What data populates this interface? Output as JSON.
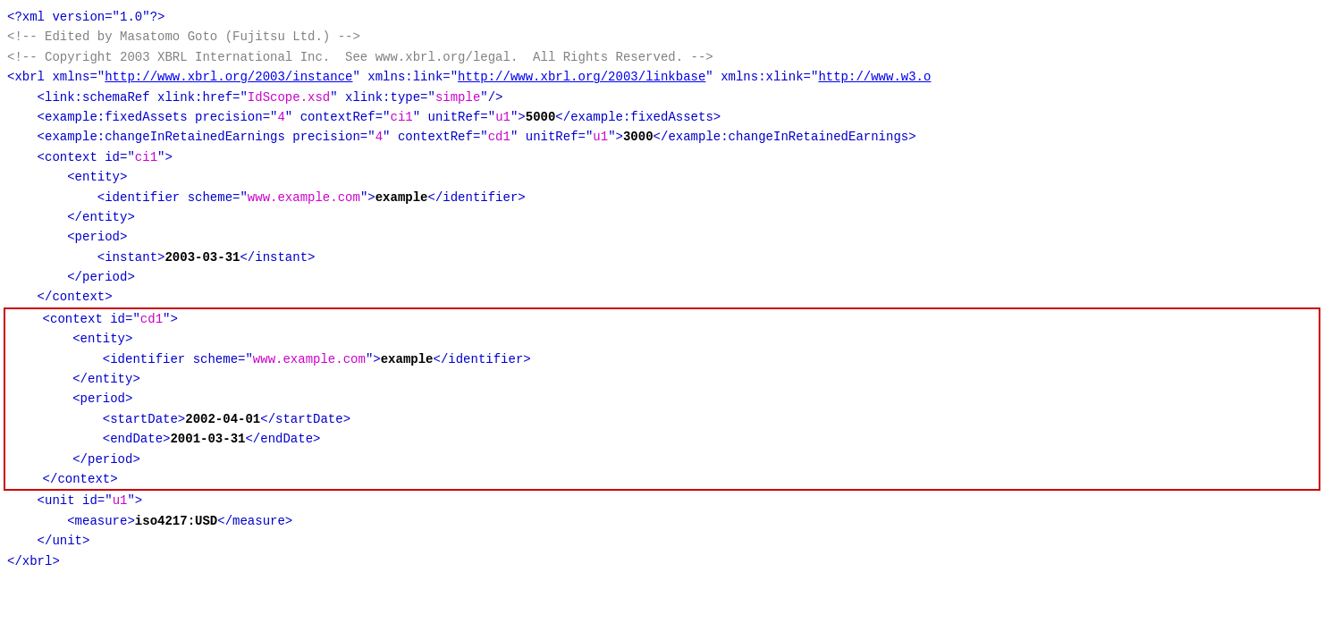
{
  "document": {
    "lines": [
      {
        "id": "line1",
        "type": "normal",
        "parts": [
          {
            "text": "<?xml version=\"1.0\"?>",
            "class": "color-blue"
          }
        ]
      },
      {
        "id": "line2",
        "type": "normal",
        "parts": [
          {
            "text": "<!-- Edited by Masatomo Goto (Fujitsu Ltd.) -->",
            "class": "color-comment"
          }
        ]
      },
      {
        "id": "line3",
        "type": "normal",
        "parts": [
          {
            "text": "<!-- Copyright 2003 XBRL International Inc.  See www.xbrl.org/legal.  All Rights Reserved. -->",
            "class": "color-comment"
          }
        ]
      },
      {
        "id": "line4",
        "type": "normal",
        "parts": [
          {
            "text": "<xbrl xmlns=\"",
            "class": "color-blue"
          },
          {
            "text": "http://www.xbrl.org/2003/instance",
            "class": "link"
          },
          {
            "text": "\" xmlns:link=\"",
            "class": "color-blue"
          },
          {
            "text": "http://www.xbrl.org/2003/linkbase",
            "class": "link"
          },
          {
            "text": "\" xmlns:xlink=\"",
            "class": "color-blue"
          },
          {
            "text": "http://www.w3.o",
            "class": "link"
          }
        ]
      },
      {
        "id": "line5",
        "type": "normal",
        "parts": [
          {
            "text": "    <link:schemaRef xlink:href=\"",
            "class": "color-blue"
          },
          {
            "text": "IdScope.xsd",
            "class": "color-magenta"
          },
          {
            "text": "\" xlink:type=\"",
            "class": "color-blue"
          },
          {
            "text": "simple",
            "class": "color-magenta"
          },
          {
            "text": "\"/>",
            "class": "color-blue"
          }
        ]
      },
      {
        "id": "line6",
        "type": "normal",
        "parts": [
          {
            "text": "    <example:fixedAssets precision=\"",
            "class": "color-blue"
          },
          {
            "text": "4",
            "class": "color-magenta"
          },
          {
            "text": "\" contextRef=\"",
            "class": "color-blue"
          },
          {
            "text": "ci1",
            "class": "color-magenta"
          },
          {
            "text": "\" unitRef=\"",
            "class": "color-blue"
          },
          {
            "text": "u1",
            "class": "color-magenta"
          },
          {
            "text": "\">",
            "class": "color-blue"
          },
          {
            "text": "5000",
            "class": "color-black bold"
          },
          {
            "text": "</example:fixedAssets>",
            "class": "color-blue"
          }
        ]
      },
      {
        "id": "line7",
        "type": "normal",
        "parts": [
          {
            "text": "    <example:changeInRetainedEarnings precision=\"",
            "class": "color-blue"
          },
          {
            "text": "4",
            "class": "color-magenta"
          },
          {
            "text": "\" contextRef=\"",
            "class": "color-blue"
          },
          {
            "text": "cd1",
            "class": "color-magenta"
          },
          {
            "text": "\" unitRef=\"",
            "class": "color-blue"
          },
          {
            "text": "u1",
            "class": "color-magenta"
          },
          {
            "text": "\">",
            "class": "color-blue"
          },
          {
            "text": "3000",
            "class": "color-black bold"
          },
          {
            "text": "</example:changeInRetainedEarnings>",
            "class": "color-blue"
          }
        ]
      },
      {
        "id": "line8",
        "type": "normal",
        "parts": [
          {
            "text": "    <context id=\"",
            "class": "color-blue"
          },
          {
            "text": "ci1",
            "class": "color-magenta"
          },
          {
            "text": "\">",
            "class": "color-blue"
          }
        ]
      },
      {
        "id": "line9",
        "type": "normal",
        "parts": [
          {
            "text": "        <entity>",
            "class": "color-blue"
          }
        ]
      },
      {
        "id": "line10",
        "type": "normal",
        "parts": [
          {
            "text": "            <identifier scheme=\"",
            "class": "color-blue"
          },
          {
            "text": "www.example.com",
            "class": "color-magenta"
          },
          {
            "text": "\">",
            "class": "color-blue"
          },
          {
            "text": "example",
            "class": "color-black bold"
          },
          {
            "text": "</identifier>",
            "class": "color-blue"
          }
        ]
      },
      {
        "id": "line11",
        "type": "normal",
        "parts": [
          {
            "text": "        </entity>",
            "class": "color-blue"
          }
        ]
      },
      {
        "id": "line12",
        "type": "normal",
        "parts": [
          {
            "text": "        <period>",
            "class": "color-blue"
          }
        ]
      },
      {
        "id": "line13",
        "type": "normal",
        "parts": [
          {
            "text": "            <instant>",
            "class": "color-blue"
          },
          {
            "text": "2003-03-31",
            "class": "color-black bold"
          },
          {
            "text": "</instant>",
            "class": "color-blue"
          }
        ]
      },
      {
        "id": "line14",
        "type": "normal",
        "parts": [
          {
            "text": "        </period>",
            "class": "color-blue"
          }
        ]
      },
      {
        "id": "line15",
        "type": "normal",
        "parts": [
          {
            "text": "    </context>",
            "class": "color-blue"
          }
        ]
      }
    ],
    "highlighted_block": {
      "lines": [
        {
          "id": "hline1",
          "parts": [
            {
              "text": "    <context id=\"",
              "class": "color-blue"
            },
            {
              "text": "cd1",
              "class": "color-magenta"
            },
            {
              "text": "\">",
              "class": "color-blue"
            }
          ]
        },
        {
          "id": "hline2",
          "parts": [
            {
              "text": "        <entity>",
              "class": "color-blue"
            }
          ]
        },
        {
          "id": "hline3",
          "parts": [
            {
              "text": "            <identifier scheme=\"",
              "class": "color-blue"
            },
            {
              "text": "www.example.com",
              "class": "color-magenta"
            },
            {
              "text": "\">",
              "class": "color-blue"
            },
            {
              "text": "example",
              "class": "color-black bold"
            },
            {
              "text": "</identifier>",
              "class": "color-blue"
            }
          ]
        },
        {
          "id": "hline4",
          "parts": [
            {
              "text": "        </entity>",
              "class": "color-blue"
            }
          ]
        },
        {
          "id": "hline5",
          "parts": [
            {
              "text": "        <period>",
              "class": "color-blue"
            }
          ]
        },
        {
          "id": "hline6",
          "parts": [
            {
              "text": "            <startDate>",
              "class": "color-blue"
            },
            {
              "text": "2002-04-01",
              "class": "color-black bold"
            },
            {
              "text": "</startDate>",
              "class": "color-blue"
            }
          ]
        },
        {
          "id": "hline7",
          "parts": [
            {
              "text": "            <endDate>",
              "class": "color-blue"
            },
            {
              "text": "2001-03-31",
              "class": "color-black bold"
            },
            {
              "text": "</endDate>",
              "class": "color-blue"
            }
          ]
        },
        {
          "id": "hline8",
          "parts": [
            {
              "text": "        </period>",
              "class": "color-blue"
            }
          ]
        },
        {
          "id": "hline9",
          "parts": [
            {
              "text": "    </context>",
              "class": "color-blue"
            }
          ]
        }
      ]
    },
    "after_lines": [
      {
        "id": "aline1",
        "parts": [
          {
            "text": "    <unit id=\"",
            "class": "color-blue"
          },
          {
            "text": "u1",
            "class": "color-magenta"
          },
          {
            "text": "\">",
            "class": "color-blue"
          }
        ]
      },
      {
        "id": "aline2",
        "parts": [
          {
            "text": "        <measure>",
            "class": "color-blue"
          },
          {
            "text": "iso4217:USD",
            "class": "color-black bold"
          },
          {
            "text": "</measure>",
            "class": "color-blue"
          }
        ]
      },
      {
        "id": "aline3",
        "parts": [
          {
            "text": "    </unit>",
            "class": "color-blue"
          }
        ]
      },
      {
        "id": "aline4",
        "parts": [
          {
            "text": "</xbrl>",
            "class": "color-blue"
          }
        ]
      }
    ]
  }
}
